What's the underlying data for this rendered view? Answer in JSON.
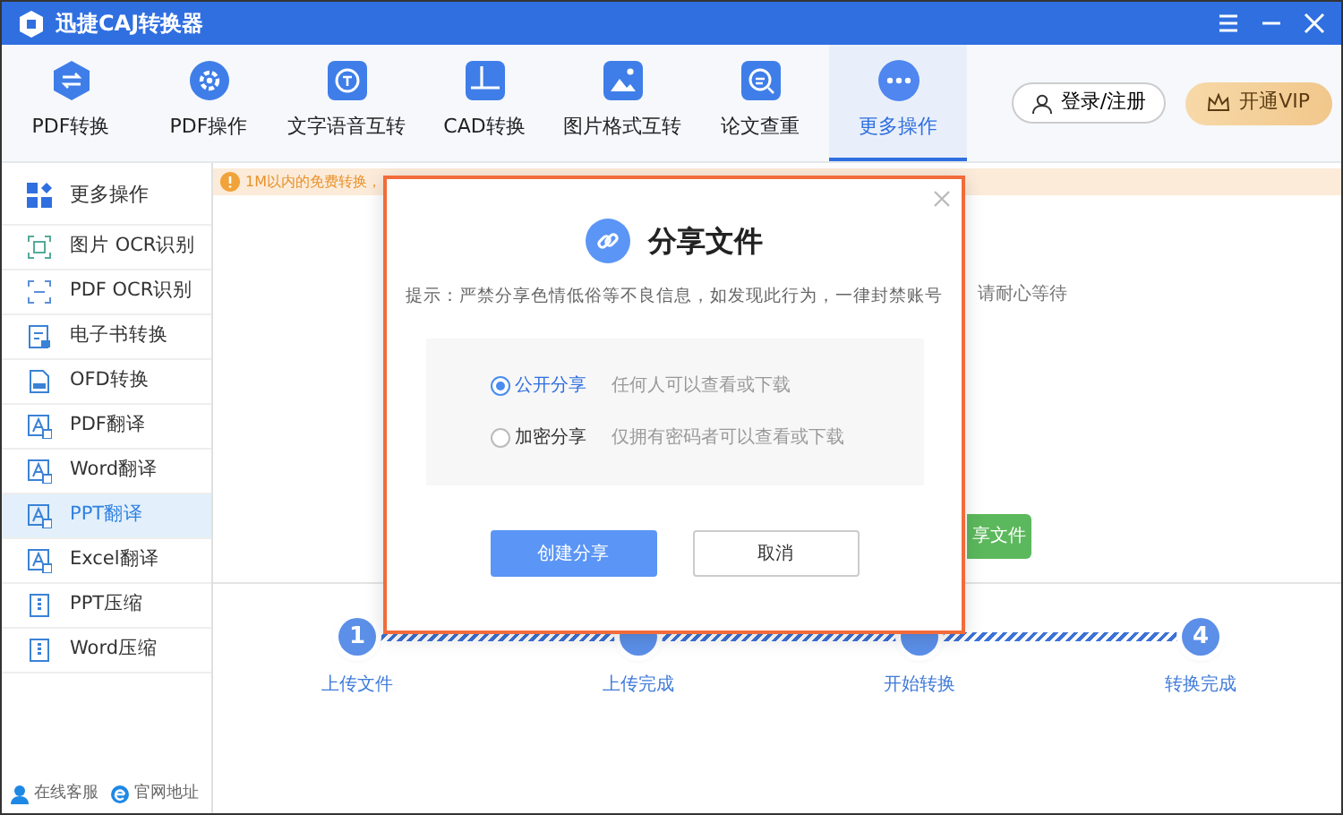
{
  "window": {
    "title": "迅捷CAJ转换器"
  },
  "toolbar": {
    "tabs": [
      {
        "label": "PDF转换",
        "selected": false
      },
      {
        "label": "PDF操作",
        "selected": false
      },
      {
        "label": "文字语音互转",
        "selected": false
      },
      {
        "label": "CAD转换",
        "selected": false
      },
      {
        "label": "图片格式互转",
        "selected": false
      },
      {
        "label": "论文查重",
        "selected": false
      },
      {
        "label": "更多操作",
        "selected": true
      }
    ],
    "login_button": "登录/注册",
    "vip_button": "开通VIP"
  },
  "sidebar": {
    "header": "更多操作",
    "items": [
      {
        "label": "图片 OCR识别",
        "selected": false
      },
      {
        "label": "PDF OCR识别",
        "selected": false
      },
      {
        "label": "电子书转换",
        "selected": false
      },
      {
        "label": "OFD转换",
        "selected": false
      },
      {
        "label": "PDF翻译",
        "selected": false
      },
      {
        "label": "Word翻译",
        "selected": false
      },
      {
        "label": "PPT翻译",
        "selected": true
      },
      {
        "label": "Excel翻译",
        "selected": false
      },
      {
        "label": "PPT压缩",
        "selected": false
      },
      {
        "label": "Word压缩",
        "selected": false
      }
    ],
    "footer_links": [
      "在线客服",
      "官网地址"
    ]
  },
  "notice": "1M以内的免费转换，",
  "background": {
    "wait_text": "请耐心等待",
    "action_button": "享文件"
  },
  "steps": [
    {
      "number": "1",
      "label": "上传文件"
    },
    {
      "label": "上传完成"
    },
    {
      "label": "开始转换"
    },
    {
      "number": "4",
      "label": "转换完成"
    }
  ],
  "dialog": {
    "title": "分享文件",
    "hint": "提示：严禁分享色情低俗等不良信息，如发现此行为，一律封禁账号",
    "options": [
      {
        "label": "公开分享",
        "description": "任何人可以查看或下载",
        "selected": true
      },
      {
        "label": "加密分享",
        "description": "仅拥有密码者可以查看或下载",
        "selected": false
      }
    ],
    "buttons": [
      "创建分享",
      "取消"
    ]
  }
}
